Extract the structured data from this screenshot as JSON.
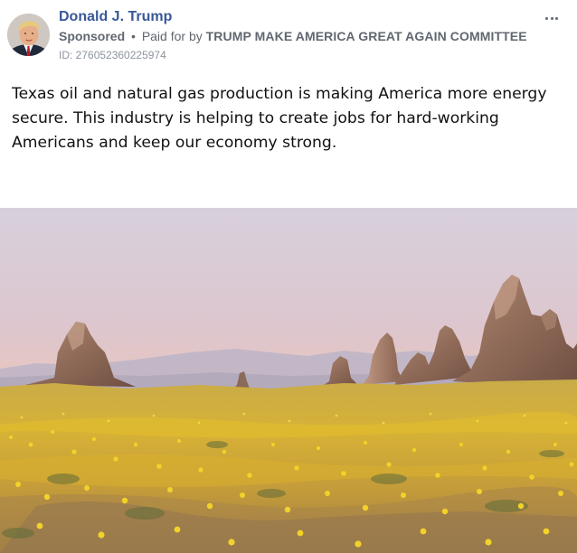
{
  "post": {
    "page_name": "Donald J. Trump",
    "sponsored_label": "Sponsored",
    "separator": "•",
    "paid_for_label": "Paid for by",
    "sponsor_name": "TRUMP MAKE AMERICA GREAT AGAIN COMMITTEE",
    "ad_id": "ID: 276052360225974",
    "message": "Texas oil and natural gas production is making America more energy secure. This industry is helping to create jobs for hard-working Americans and keep our economy strong.",
    "more_icon": "ellipsis-icon",
    "avatar_icon": "profile-photo",
    "photo_icon": "desert-landscape-photo"
  },
  "colors": {
    "page_name": "#385898",
    "secondary_text": "#606770",
    "id_text": "#8d949e",
    "message_text": "#111111"
  }
}
